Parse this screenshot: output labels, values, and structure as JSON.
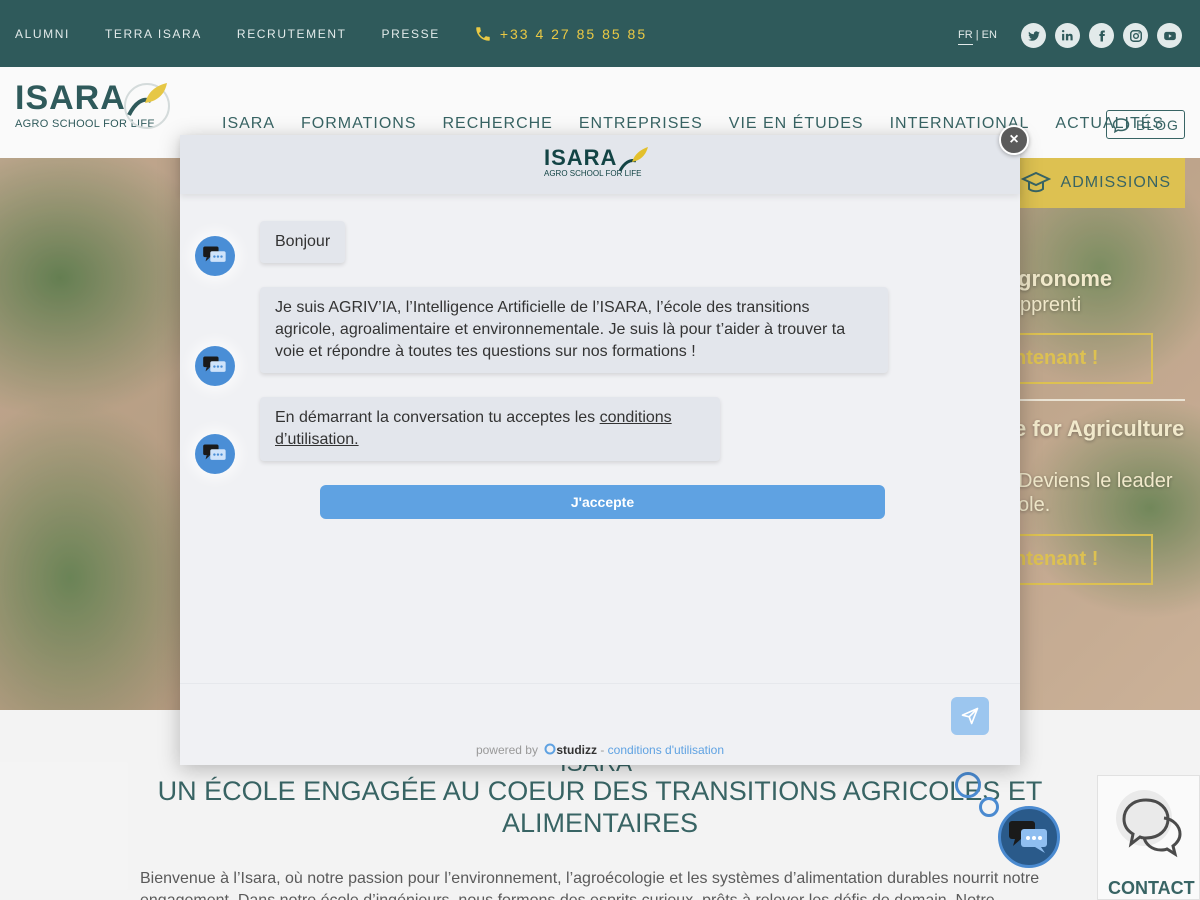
{
  "topbar": {
    "links": [
      "ALUMNI",
      "TERRA ISARA",
      "RECRUTEMENT",
      "PRESSE"
    ],
    "phone": "+33 4 27 85 85 85",
    "lang_fr": "FR",
    "lang_sep": "|",
    "lang_en": "EN",
    "socials": [
      "twitter-icon",
      "linkedin-icon",
      "facebook-icon",
      "instagram-icon",
      "youtube-icon"
    ]
  },
  "header": {
    "logo_word": "ISARA",
    "logo_tagline": "AGRO SCHOOL FOR LIFE",
    "nav": [
      "ISARA",
      "FORMATIONS",
      "RECHERCHE",
      "ENTREPRISES",
      "VIE EN ÉTUDES",
      "INTERNATIONAL",
      "ACTUALITÉS"
    ],
    "blog_label": "BLOG"
  },
  "hero": {
    "admissions_label": "ADMISSIONS",
    "line1": "gronome",
    "line2": "pprenti",
    "btn1": "ntenant !",
    "line3": "e for Agriculture",
    "line4": "Deviens le leader",
    "line5": "ole.",
    "btn2": "ntenant !"
  },
  "content": {
    "heading_small": "ISARA",
    "heading": "UN ÉCOLE ENGAGÉE AU COEUR DES  TRANSITIONS AGRICOLES ET ALIMENTAIRES",
    "intro": "Bienvenue à l’Isara, où notre passion pour l’environnement, l’agroécologie et les systèmes d’alimentation durables nourrit notre engagement. Dans notre école d’ingénieurs, nous formons des esprits curieux, prêts à relever les défis de demain. Notre"
  },
  "contact": {
    "label": "CONTACT"
  },
  "chat": {
    "logo_word": "ISARA",
    "logo_tagline": "AGRO SCHOOL FOR LIFE",
    "messages": [
      {
        "text": "Bonjour"
      },
      {
        "text": "Je suis AGRIV’IA, l’Intelligence Artificielle de l’ISARA, l’école des transitions agricole, agroalimentaire et environnementale. Je suis là pour t’aider à trouver ta voie et répondre à toutes tes questions sur nos formations !"
      },
      {
        "text_before": "En démarrant la conversation tu acceptes les ",
        "link": "conditions d’utilisation."
      }
    ],
    "accept_label": "J'accepte",
    "input_placeholder": "",
    "footer_powered": "powered by",
    "footer_brand": "studizz",
    "footer_sep": " - ",
    "footer_terms": "conditions d'utilisation",
    "close_label": "×",
    "accent": "#5fa2e2"
  }
}
